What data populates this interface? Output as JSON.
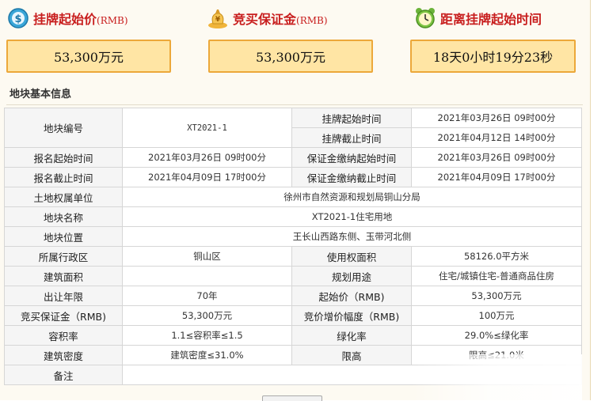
{
  "stats": [
    {
      "icon": "dollar-coin-icon",
      "title": "挂牌起始价",
      "unit": "(RMB)",
      "value": "53,300万元"
    },
    {
      "icon": "money-bag-icon",
      "title": "竞买保证金",
      "unit": "(RMB)",
      "value": "53,300万元"
    },
    {
      "icon": "alarm-clock-icon",
      "title": "距离挂牌起始时间",
      "unit": "",
      "value": "18天0小时19分23秒"
    }
  ],
  "section": {
    "title": "地块基本信息"
  },
  "table": {
    "parcel_no_label": "地块编号",
    "parcel_no": "XT2021-1",
    "listing_start_label": "挂牌起始时间",
    "listing_start": "2021年03月26日 09时00分",
    "listing_end_label": "挂牌截止时间",
    "listing_end": "2021年04月12日 14时00分",
    "reg_start_label": "报名起始时间",
    "reg_start": "2021年03月26日 09时00分",
    "deposit_start_label": "保证金缴纳起始时间",
    "deposit_start": "2021年03月26日 09时00分",
    "reg_end_label": "报名截止时间",
    "reg_end": "2021年04月09日 17时00分",
    "deposit_end_label": "保证金缴纳截止时间",
    "deposit_end": "2021年04月09日 17时00分",
    "owner_label": "土地权属单位",
    "owner": "徐州市自然资源和规划局铜山分局",
    "name_label": "地块名称",
    "name": "XT2021-1住宅用地",
    "location_label": "地块位置",
    "location": "王长山西路东侧、玉带河北侧",
    "district_label": "所属行政区",
    "district": "铜山区",
    "use_area_label": "使用权面积",
    "use_area": "58126.0平方米",
    "build_area_label": "建筑面积",
    "build_area": "",
    "planned_use_label": "规划用途",
    "planned_use": "住宅/城镇住宅-普通商品住房",
    "term_label": "出让年限",
    "term": "70年",
    "start_price_label": "起始价（RMB)",
    "start_price": "53,300万元",
    "deposit_label": "竞买保证金（RMB)",
    "deposit": "53,300万元",
    "increment_label": "竞价增价幅度（RMB)",
    "increment": "100万元",
    "far_label": "容积率",
    "far": "1.1≤容积率≤1.5",
    "green_label": "绿化率",
    "green": "29.0%≤绿化率",
    "density_label": "建筑密度",
    "density": "建筑密度≤31.0%",
    "height_label": "限高",
    "height": "限高≤21.0米",
    "remarks_label": "备注",
    "remarks": ""
  },
  "colors": {
    "title_red": "#c81e1e",
    "box_fill": "#ffe5a4",
    "box_border": "#eca83a"
  }
}
